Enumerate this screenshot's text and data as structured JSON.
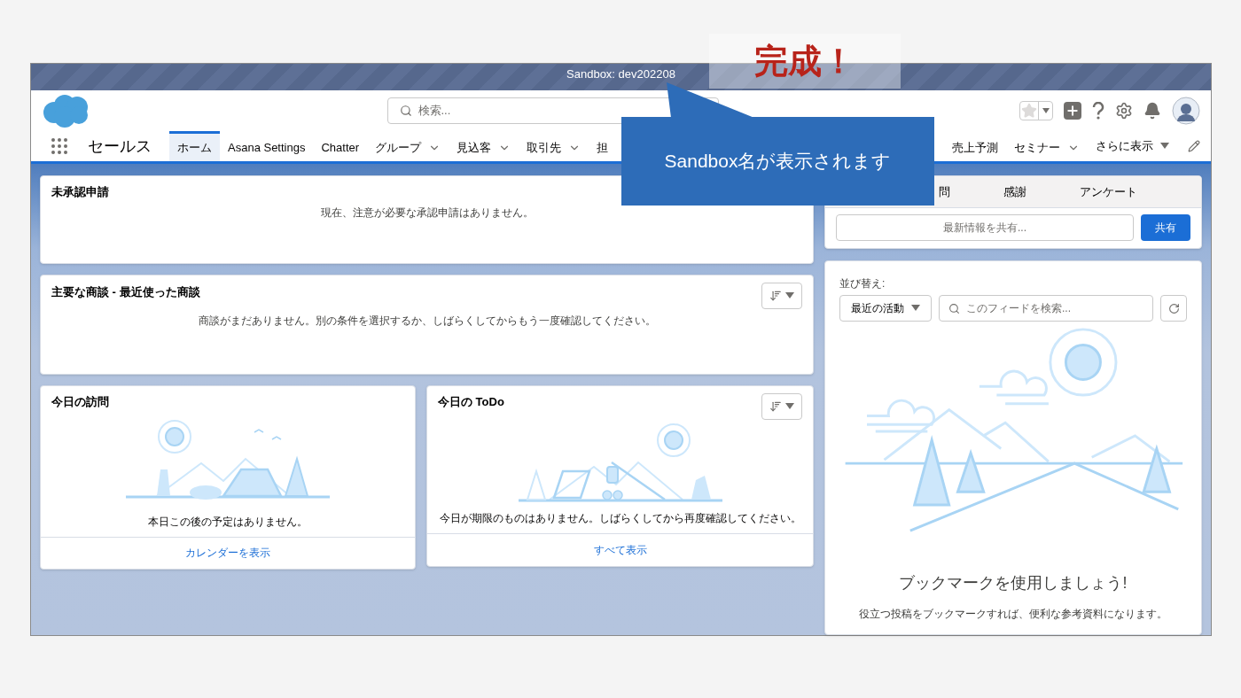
{
  "annotations": {
    "title": "完成！",
    "callout": "Sandbox名が表示されます"
  },
  "sandbox_bar": {
    "label": "Sandbox: dev202208"
  },
  "header": {
    "search": {
      "placeholder": "検索..."
    }
  },
  "nav": {
    "app_name": "セールス",
    "tabs_left": [
      {
        "label": "ホーム",
        "selected": true,
        "dropdown": false
      },
      {
        "label": "Asana Settings",
        "selected": false,
        "dropdown": false
      },
      {
        "label": "Chatter",
        "selected": false,
        "dropdown": false
      },
      {
        "label": "グループ",
        "selected": false,
        "dropdown": true
      },
      {
        "label": "見込客",
        "selected": false,
        "dropdown": true
      },
      {
        "label": "取引先",
        "selected": false,
        "dropdown": true
      },
      {
        "label": "担",
        "selected": false,
        "dropdown": false
      }
    ],
    "tabs_right": [
      {
        "label": "売上予測",
        "selected": false,
        "dropdown": false
      },
      {
        "label": "セミナー",
        "selected": false,
        "dropdown": true
      }
    ],
    "more": "さらに表示"
  },
  "approvals": {
    "title": "未承認申請",
    "message": "現在、注意が必要な承認申請はありません。"
  },
  "opportunities": {
    "title": "主要な商談 - 最近使った商談",
    "message": "商談がまだありません。別の条件を選択するか、しばらくしてからもう一度確認してください。"
  },
  "visits": {
    "title": "今日の訪問",
    "message": "本日この後の予定はありません。",
    "link": "カレンダーを表示"
  },
  "todo": {
    "title": "今日の ToDo",
    "message": "今日が期限のものはありません。しばらくしてから再度確認してください。",
    "link": "すべて表示"
  },
  "publisher": {
    "tabs": [
      "問",
      "感謝",
      "アンケート"
    ],
    "placeholder": "最新情報を共有...",
    "button": "共有"
  },
  "feed": {
    "sort_label": "並び替え:",
    "sort_value": "最近の活動",
    "search_placeholder": "このフィードを検索...",
    "empty_title": "ブックマークを使用しましょう!",
    "empty_text": "役立つ投稿をブックマークすれば、便利な参考資料になります。"
  }
}
